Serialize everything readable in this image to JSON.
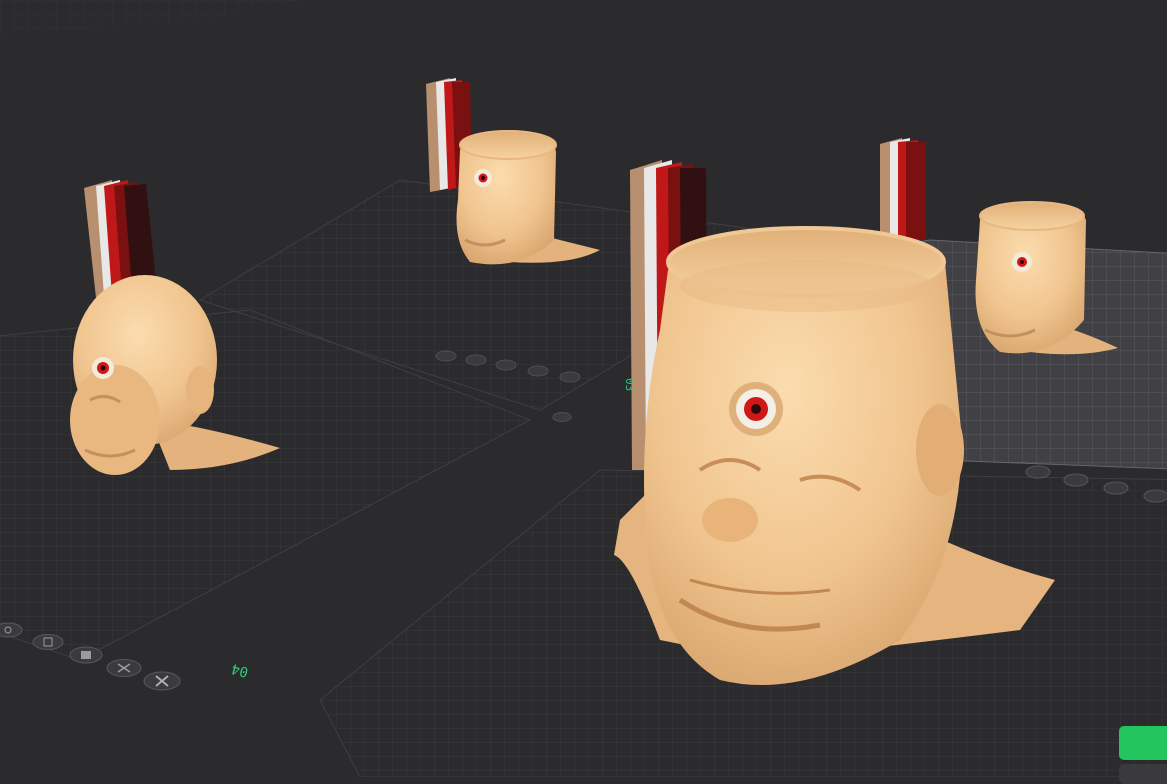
{
  "scene": {
    "background_color": "#2b2b2e",
    "grid_color": "#3c3c41",
    "model_color": "#f0c896",
    "eye_color": "#d01818"
  },
  "plates": [
    {
      "index": 1,
      "label": "",
      "buttons": [
        "orient-icon",
        "arrange-icon",
        "lock-icon",
        "settings-icon",
        "close-icon"
      ]
    },
    {
      "index": 2,
      "label": "",
      "buttons": [
        "orient-icon",
        "arrange-icon",
        "lock-icon",
        "settings-icon",
        "close-icon"
      ]
    },
    {
      "index": 3,
      "label": "",
      "buttons": [
        "orient-icon",
        "arrange-icon",
        "lock-icon",
        "settings-icon"
      ]
    },
    {
      "index": 4,
      "label": "04",
      "buttons": [
        "orient-icon",
        "arrange-icon",
        "lock-icon",
        "settings-icon",
        "close-icon"
      ]
    },
    {
      "index": 5,
      "label": "03",
      "buttons": []
    }
  ],
  "wipe_tower": {
    "stripe_colors": [
      "#b89070",
      "#e8e8e8",
      "#c01818",
      "#7a1010",
      "#301010"
    ]
  },
  "slice_button": {
    "color": "#22c55e"
  }
}
